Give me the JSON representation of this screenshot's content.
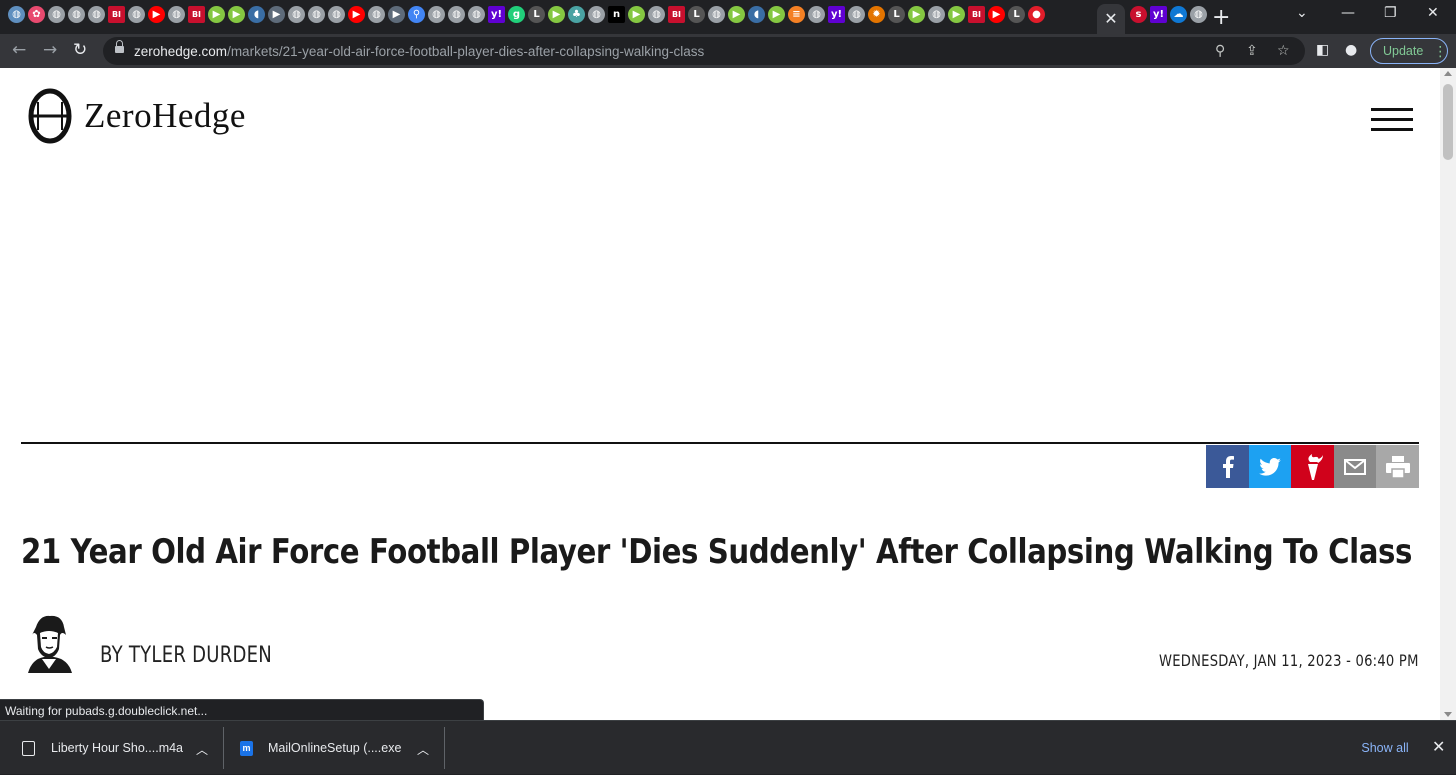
{
  "browser": {
    "tab_favicons": [
      {
        "name": "globe-favicon",
        "color": "#5f8fbf",
        "glyph": "◍"
      },
      {
        "name": "pinwheel-favicon",
        "color": "#e84a6f",
        "glyph": "✿"
      },
      {
        "name": "globe-favicon",
        "color": "#9aa0a6",
        "glyph": "◍"
      },
      {
        "name": "globe-favicon",
        "color": "#9aa0a6",
        "glyph": "◍"
      },
      {
        "name": "globe-favicon",
        "color": "#9aa0a6",
        "glyph": "◍"
      },
      {
        "name": "bi-favicon",
        "color": "#c8102e",
        "glyph": "BI"
      },
      {
        "name": "globe-favicon",
        "color": "#9aa0a6",
        "glyph": "◍"
      },
      {
        "name": "youtube-favicon",
        "color": "#ff0000",
        "glyph": "▶"
      },
      {
        "name": "globe-favicon",
        "color": "#9aa0a6",
        "glyph": "◍"
      },
      {
        "name": "bi-favicon",
        "color": "#c8102e",
        "glyph": "BI"
      },
      {
        "name": "rumble-favicon",
        "color": "#85c742",
        "glyph": "▶"
      },
      {
        "name": "rumble-favicon",
        "color": "#85c742",
        "glyph": "▶"
      },
      {
        "name": "shield-favicon",
        "color": "#3a6ea5",
        "glyph": "◖"
      },
      {
        "name": "bitchute-favicon",
        "color": "#5e6b7a",
        "glyph": "▶"
      },
      {
        "name": "globe-favicon",
        "color": "#9aa0a6",
        "glyph": "◍"
      },
      {
        "name": "globe-favicon",
        "color": "#9aa0a6",
        "glyph": "◍"
      },
      {
        "name": "globe-favicon",
        "color": "#9aa0a6",
        "glyph": "◍"
      },
      {
        "name": "youtube-favicon",
        "color": "#ff0000",
        "glyph": "▶"
      },
      {
        "name": "globe-favicon",
        "color": "#9aa0a6",
        "glyph": "◍"
      },
      {
        "name": "bitchute-favicon",
        "color": "#5e6b7a",
        "glyph": "▶"
      },
      {
        "name": "search-favicon",
        "color": "#4285f4",
        "glyph": "⚲"
      },
      {
        "name": "globe-favicon",
        "color": "#9aa0a6",
        "glyph": "◍"
      },
      {
        "name": "globe-favicon",
        "color": "#9aa0a6",
        "glyph": "◍"
      },
      {
        "name": "globe-favicon",
        "color": "#9aa0a6",
        "glyph": "◍"
      },
      {
        "name": "yahoo-favicon",
        "color": "#6001d2",
        "glyph": "y!"
      },
      {
        "name": "gab-favicon",
        "color": "#21cf7a",
        "glyph": "g"
      },
      {
        "name": "ll-favicon",
        "color": "#555555",
        "glyph": "L"
      },
      {
        "name": "rumble-favicon",
        "color": "#85c742",
        "glyph": "▶"
      },
      {
        "name": "tree-favicon",
        "color": "#4aa3a3",
        "glyph": "♣"
      },
      {
        "name": "globe-favicon",
        "color": "#9aa0a6",
        "glyph": "◍"
      },
      {
        "name": "n-favicon",
        "color": "#000000",
        "glyph": "n"
      },
      {
        "name": "rumble-favicon",
        "color": "#85c742",
        "glyph": "▶"
      },
      {
        "name": "globe-favicon",
        "color": "#9aa0a6",
        "glyph": "◍"
      },
      {
        "name": "bi-favicon",
        "color": "#c8102e",
        "glyph": "BI"
      },
      {
        "name": "ll-favicon",
        "color": "#555555",
        "glyph": "L"
      },
      {
        "name": "globe-favicon",
        "color": "#9aa0a6",
        "glyph": "◍"
      },
      {
        "name": "rumble-favicon",
        "color": "#85c742",
        "glyph": "▶"
      },
      {
        "name": "shield-favicon",
        "color": "#3a6ea5",
        "glyph": "◖"
      },
      {
        "name": "rumble-favicon",
        "color": "#85c742",
        "glyph": "▶"
      },
      {
        "name": "bookmark-favicon",
        "color": "#f48024",
        "glyph": "≡"
      },
      {
        "name": "globe-favicon",
        "color": "#9aa0a6",
        "glyph": "◍"
      },
      {
        "name": "yahoo-favicon",
        "color": "#6001d2",
        "glyph": "y!"
      },
      {
        "name": "globe-favicon",
        "color": "#9aa0a6",
        "glyph": "◍"
      },
      {
        "name": "sun-favicon",
        "color": "#e37400",
        "glyph": "✹"
      },
      {
        "name": "ll-favicon",
        "color": "#555555",
        "glyph": "L"
      },
      {
        "name": "rumble-favicon",
        "color": "#85c742",
        "glyph": "▶"
      },
      {
        "name": "globe-favicon",
        "color": "#9aa0a6",
        "glyph": "◍"
      },
      {
        "name": "rumble-favicon",
        "color": "#85c742",
        "glyph": "▶"
      },
      {
        "name": "bi-favicon",
        "color": "#c8102e",
        "glyph": "BI"
      },
      {
        "name": "youtube-favicon",
        "color": "#ff0000",
        "glyph": "▶"
      },
      {
        "name": "ll-favicon",
        "color": "#555555",
        "glyph": "L"
      },
      {
        "name": "mic-favicon",
        "color": "#e11d2a",
        "glyph": "●"
      }
    ],
    "tab_favicons_after": [
      {
        "name": "s-favicon",
        "color": "#c8102e",
        "glyph": "s"
      },
      {
        "name": "yahoo-favicon",
        "color": "#6001d2",
        "glyph": "y!"
      },
      {
        "name": "onedrive-favicon",
        "color": "#0f78d4",
        "glyph": "☁"
      },
      {
        "name": "globe-favicon",
        "color": "#9aa0a6",
        "glyph": "◍"
      }
    ],
    "url_host": "zerohedge.com",
    "url_path": "/markets/21-year-old-air-force-football-player-dies-after-collapsing-walking-class",
    "update_label": "Update",
    "status_text": "Waiting for pubads.g.doubleclick.net..."
  },
  "site": {
    "logo_text": "ZeroHedge"
  },
  "article": {
    "headline": "21 Year Old Air Force Football Player 'Dies Suddenly' After Collapsing Walking To Class",
    "byline": "BY TYLER DURDEN",
    "dateline": "WEDNESDAY, JAN 11, 2023 - 06:40 PM"
  },
  "share_buttons": [
    {
      "name": "facebook-share-button",
      "icon": "facebook-icon",
      "color": "#3b5998"
    },
    {
      "name": "twitter-share-button",
      "icon": "twitter-icon",
      "color": "#1da1f2"
    },
    {
      "name": "gab-share-button",
      "icon": "torch-icon",
      "color": "#d0021b"
    },
    {
      "name": "email-share-button",
      "icon": "mail-icon",
      "color": "#8a8a8a"
    },
    {
      "name": "print-share-button",
      "icon": "printer-icon",
      "color": "#a8a8a8"
    }
  ],
  "downloads": {
    "items": [
      {
        "name": "Liberty Hour Sho....m4a",
        "icon_color": "#e8eaed"
      },
      {
        "name": "MailOnlineSetup (....exe",
        "icon_color": "#1a73e8"
      }
    ],
    "show_all_label": "Show all"
  }
}
